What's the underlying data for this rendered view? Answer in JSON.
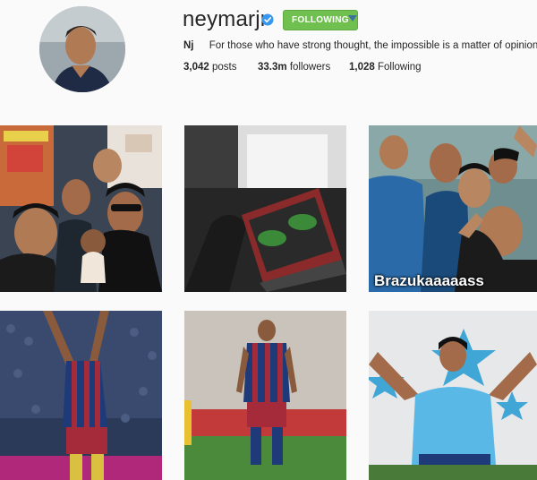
{
  "profile": {
    "username": "neymarjr",
    "verified_icon": "verified-badge-icon",
    "follow_button_label": "FOLLOWING",
    "follow_button_color": "#70c050",
    "bio_name": "Nj",
    "bio_text": "For those who have strong thought, the impossible is a matter of opinion !!!",
    "stats": {
      "posts_count": "3,042",
      "posts_label": "posts",
      "followers_count": "33.3m",
      "followers_label": "followers",
      "following_count": "1,028",
      "following_label": "Following"
    }
  },
  "grid": {
    "photos": [
      {
        "subject": "group-selfie-with-doll",
        "caption": ""
      },
      {
        "subject": "laptop-poker-game",
        "caption": ""
      },
      {
        "subject": "team-selfie",
        "caption": "Brazukaaaaass"
      },
      {
        "subject": "celebration-arms-raised",
        "caption": ""
      },
      {
        "subject": "player-walking-on-pitch",
        "caption": ""
      },
      {
        "subject": "training-arms-outstretched",
        "caption": ""
      }
    ]
  },
  "colors": {
    "background": "#fafafa",
    "accent_blue": "#3f729b",
    "verified_blue": "#3897f0"
  }
}
